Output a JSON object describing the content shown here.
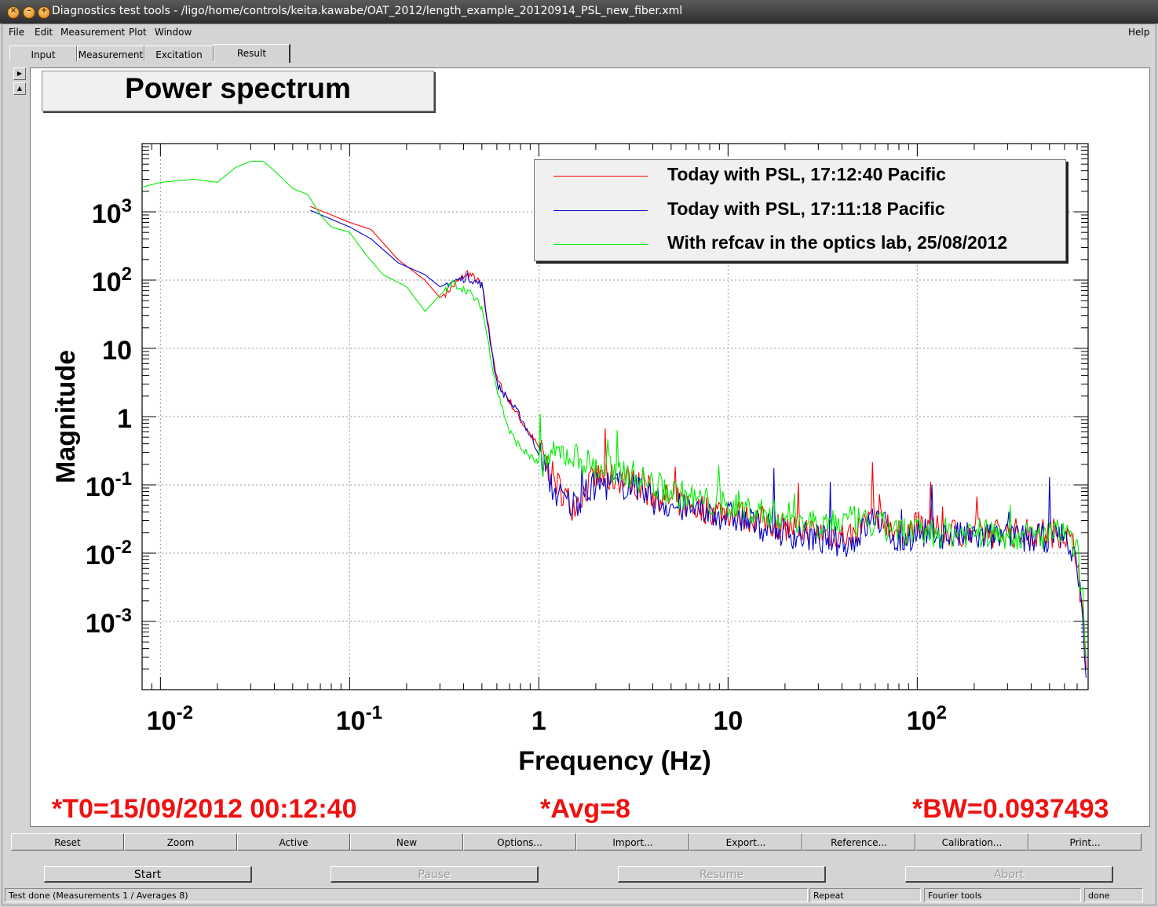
{
  "window": {
    "title": "Diagnostics test tools - /ligo/home/controls/keita.kawabe/OAT_2012/length_example_20120914_PSL_new_fiber.xml"
  },
  "menu": {
    "file": "File",
    "edit": "Edit",
    "measurement": "Measurement",
    "plot": "Plot",
    "window": "Window",
    "help": "Help"
  },
  "tabs": [
    "Input",
    "Measurement",
    "Excitation",
    "Result"
  ],
  "plot": {
    "title": "Power spectrum",
    "info_t0": "*T0=15/09/2012 00:12:40",
    "info_avg": "*Avg=8",
    "info_bw": "*BW=0.0937493"
  },
  "chart_data": {
    "type": "line",
    "title": "Power spectrum",
    "xlabel": "Frequency (Hz)",
    "ylabel": "Magnitude",
    "xscale": "log",
    "yscale": "log",
    "xlim": [
      0.008,
      800
    ],
    "ylim": [
      0.0001,
      10000
    ],
    "grid": true,
    "legend_position": "top-right",
    "x_tick_labels": [
      "10-2",
      "10-1",
      "1",
      "10",
      "102"
    ],
    "y_tick_labels": [
      "103",
      "102",
      "10",
      "1",
      "10-1",
      "10-2",
      "10-3"
    ],
    "series": [
      {
        "name": "Today with PSL, 17:12:40 Pacific",
        "color": "#ff0000",
        "x": [
          0.062,
          0.1,
          0.13,
          0.18,
          0.25,
          0.3,
          0.35,
          0.42,
          0.5,
          0.6,
          0.8,
          1.0,
          1.2,
          1.5,
          2,
          3,
          4,
          5,
          7,
          10,
          15,
          20,
          30,
          45,
          60,
          80,
          100,
          150,
          200,
          300,
          400,
          500,
          600,
          700,
          750,
          780
        ],
        "y": [
          1200,
          700,
          550,
          200,
          100,
          55,
          80,
          130,
          85,
          3.5,
          0.9,
          0.35,
          0.12,
          0.05,
          0.13,
          0.12,
          0.07,
          0.06,
          0.045,
          0.04,
          0.03,
          0.025,
          0.02,
          0.018,
          0.04,
          0.02,
          0.025,
          0.02,
          0.02,
          0.02,
          0.02,
          0.02,
          0.02,
          0.01,
          0.001,
          0.0002
        ]
      },
      {
        "name": "Today with PSL, 17:11:18 Pacific",
        "color": "#0000cc",
        "x": [
          0.062,
          0.1,
          0.13,
          0.18,
          0.25,
          0.3,
          0.35,
          0.42,
          0.5,
          0.6,
          0.8,
          1.0,
          1.2,
          1.5,
          2,
          3,
          4,
          5,
          7,
          10,
          15,
          20,
          30,
          45,
          60,
          80,
          100,
          150,
          200,
          300,
          400,
          500,
          600,
          700,
          750,
          780
        ],
        "y": [
          1050,
          600,
          400,
          180,
          120,
          80,
          95,
          110,
          85,
          3.0,
          1.0,
          0.3,
          0.08,
          0.05,
          0.1,
          0.1,
          0.06,
          0.05,
          0.04,
          0.035,
          0.025,
          0.02,
          0.016,
          0.014,
          0.035,
          0.015,
          0.02,
          0.018,
          0.017,
          0.017,
          0.016,
          0.017,
          0.018,
          0.008,
          0.0008,
          0.00015
        ]
      },
      {
        "name": "With refcav in the optics lab, 25/08/2012",
        "color": "#00ee00",
        "x": [
          0.008,
          0.01,
          0.015,
          0.02,
          0.025,
          0.03,
          0.035,
          0.04,
          0.05,
          0.06,
          0.07,
          0.08,
          0.1,
          0.12,
          0.15,
          0.2,
          0.25,
          0.3,
          0.35,
          0.42,
          0.5,
          0.6,
          0.7,
          0.8,
          1.0,
          1.3,
          1.6,
          2,
          3,
          4,
          5,
          7,
          10,
          15,
          20,
          30,
          45,
          60,
          80,
          100,
          150,
          200,
          300,
          400,
          500,
          600,
          700,
          750,
          780
        ],
        "y": [
          2300,
          2700,
          3000,
          2700,
          4500,
          5500,
          5500,
          4000,
          2200,
          1800,
          900,
          600,
          500,
          250,
          120,
          80,
          35,
          60,
          90,
          70,
          40,
          2.5,
          0.6,
          0.35,
          0.2,
          0.3,
          0.25,
          0.18,
          0.15,
          0.1,
          0.08,
          0.06,
          0.05,
          0.04,
          0.035,
          0.028,
          0.03,
          0.025,
          0.022,
          0.02,
          0.02,
          0.02,
          0.018,
          0.018,
          0.018,
          0.02,
          0.01,
          0.002,
          0.0003
        ]
      }
    ]
  },
  "buttons": [
    "Reset",
    "Zoom",
    "Active",
    "New",
    "Options...",
    "Import...",
    "Export...",
    "Reference...",
    "Calibration...",
    "Print..."
  ],
  "controls": [
    "Start",
    "Pause",
    "Resume",
    "Abort"
  ],
  "status": {
    "message": "Test done (Measurements 1 / Averages 8)",
    "mode": "Repeat",
    "tool": "Fourier tools",
    "state": "done"
  }
}
